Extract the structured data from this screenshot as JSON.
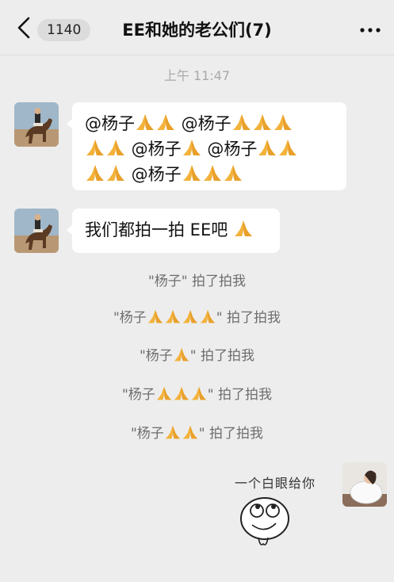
{
  "header": {
    "back_icon": "chevron-left-icon",
    "unread_count": "1140",
    "title": "EE和她的老公们(7)",
    "more_icon": "more-dots-icon"
  },
  "timestamp": "上午 11:47",
  "messages": [
    {
      "sender": "left",
      "avatar": "horse-rider-avatar",
      "lines": [
        [
          "@杨子",
          "pray",
          "pray",
          " @杨子",
          "pray",
          "pray",
          "pray"
        ],
        [
          "pray",
          "pray",
          " @杨子",
          "pray",
          " @杨子",
          "pray",
          "pray"
        ],
        [
          "pray",
          "pray",
          " @杨子",
          "pray",
          "pray",
          "pray"
        ]
      ]
    },
    {
      "sender": "left",
      "avatar": "horse-rider-avatar",
      "text": "我们都拍一拍 EE吧 "
    }
  ],
  "system_messages": [
    {
      "pre": "\"杨子\" 拍了拍我",
      "prays": 0
    },
    {
      "pre": "\"杨子",
      "prays": 4,
      "post": "\" 拍了拍我"
    },
    {
      "pre": "\"杨子",
      "prays": 1,
      "post": "\" 拍了拍我"
    },
    {
      "pre": "\"杨子",
      "prays": 3,
      "post": "\" 拍了拍我"
    },
    {
      "pre": "\"杨子",
      "prays": 2,
      "post": "\" 拍了拍我"
    }
  ],
  "sticker": {
    "text": "一个白眼给你",
    "image": "eye-roll-face-sticker"
  },
  "colors": {
    "background": "#ededed",
    "bubble": "#ffffff",
    "system_text": "#6e6e6e",
    "timestamp": "#a9a9a9",
    "pray_emoji": "#f3b23a"
  }
}
